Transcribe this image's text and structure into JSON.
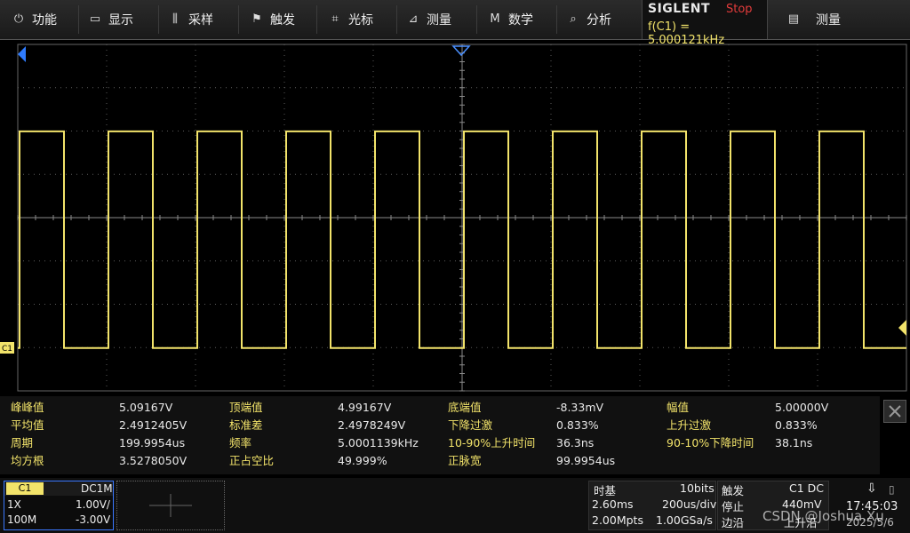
{
  "menu": {
    "items": [
      {
        "icon": "power-icon",
        "glyph": "⏻",
        "label": "功能"
      },
      {
        "icon": "display-icon",
        "glyph": "▭",
        "label": "显示"
      },
      {
        "icon": "acquire-icon",
        "glyph": "⫼",
        "label": "采样"
      },
      {
        "icon": "trigger-icon",
        "glyph": "⚑",
        "label": "触发"
      },
      {
        "icon": "cursor-icon",
        "glyph": "⌗",
        "label": "光标"
      },
      {
        "icon": "measure-icon",
        "glyph": "⊿",
        "label": "测量"
      },
      {
        "icon": "math-icon",
        "glyph": "M",
        "label": "数学"
      },
      {
        "icon": "analysis-icon",
        "glyph": "⌕",
        "label": "分析"
      }
    ],
    "brand": "SIGLENT",
    "run_state": "Stop",
    "freq_readout": "f(C1) = 5.000121kHz",
    "right_label": "测量",
    "right_icon": "list-icon"
  },
  "colors": {
    "trace": "#f2e36a",
    "grid": "#5a5a5a",
    "trigger": "#4a90ff",
    "stop": "#e23b3b"
  },
  "waveform": {
    "channel_tag": "C1",
    "high_level_v": 4.99167,
    "low_level_v": -0.00833,
    "period_us": 199.9954,
    "timebase_us_per_div": 200
  },
  "measurements": {
    "rows": [
      [
        {
          "label": "峰峰值",
          "value": "5.09167V"
        },
        {
          "label": "顶端值",
          "value": "4.99167V"
        },
        {
          "label": "底端值",
          "value": "-8.33mV"
        },
        {
          "label": "幅值",
          "value": "5.00000V"
        }
      ],
      [
        {
          "label": "平均值",
          "value": "2.4912405V"
        },
        {
          "label": "标准差",
          "value": "2.4978249V"
        },
        {
          "label": "下降过激",
          "value": "0.833%"
        },
        {
          "label": "上升过激",
          "value": "0.833%"
        }
      ],
      [
        {
          "label": "周期",
          "value": "199.9954us"
        },
        {
          "label": "频率",
          "value": "5.0001139kHz"
        },
        {
          "label": "10-90%上升时间",
          "value": "36.3ns"
        },
        {
          "label": "90-10%下降时间",
          "value": "38.1ns"
        }
      ],
      [
        {
          "label": "均方根",
          "value": "3.5278050V"
        },
        {
          "label": "正占空比",
          "value": "49.999%"
        },
        {
          "label": "正脉宽",
          "value": "99.9954us"
        }
      ]
    ]
  },
  "channel": {
    "name": "C1",
    "coupling": "DC1M",
    "probe": "1X",
    "scale": "1.00V/",
    "bandwidth": "100M",
    "offset": "-3.00V"
  },
  "timebase": {
    "label": "时基",
    "bits": "10bits",
    "delay": "2.60ms",
    "scale": "200us/div",
    "memory": "2.00Mpts",
    "rate": "1.00GSa/s"
  },
  "trigger": {
    "label": "触发",
    "source": "C1 DC",
    "mode": "停止",
    "level": "440mV",
    "type": "边沿",
    "slope": "上升沿"
  },
  "status": {
    "time": "17:45:03",
    "date": "2025/5/6",
    "usb_icon": "usb-icon",
    "watermark": "CSDN @Joshua.Xu"
  }
}
